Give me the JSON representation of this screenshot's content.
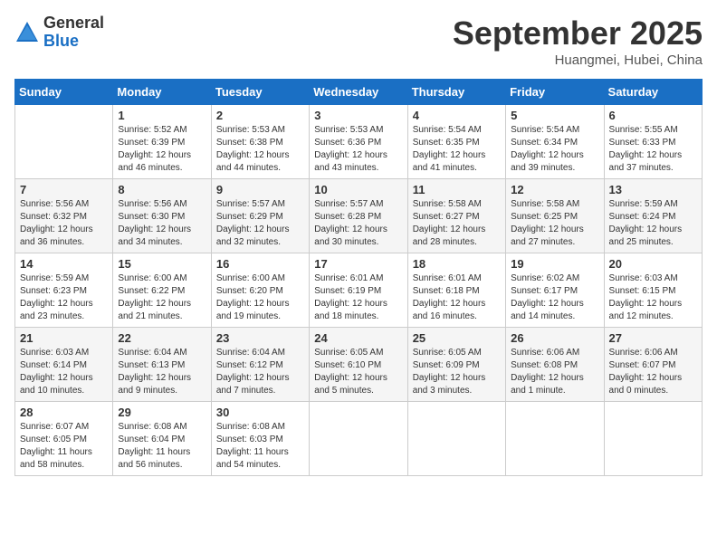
{
  "logo": {
    "general": "General",
    "blue": "Blue"
  },
  "header": {
    "month": "September 2025",
    "location": "Huangmei, Hubei, China"
  },
  "weekdays": [
    "Sunday",
    "Monday",
    "Tuesday",
    "Wednesday",
    "Thursday",
    "Friday",
    "Saturday"
  ],
  "weeks": [
    [
      {
        "day": "",
        "info": ""
      },
      {
        "day": "1",
        "info": "Sunrise: 5:52 AM\nSunset: 6:39 PM\nDaylight: 12 hours\nand 46 minutes."
      },
      {
        "day": "2",
        "info": "Sunrise: 5:53 AM\nSunset: 6:38 PM\nDaylight: 12 hours\nand 44 minutes."
      },
      {
        "day": "3",
        "info": "Sunrise: 5:53 AM\nSunset: 6:36 PM\nDaylight: 12 hours\nand 43 minutes."
      },
      {
        "day": "4",
        "info": "Sunrise: 5:54 AM\nSunset: 6:35 PM\nDaylight: 12 hours\nand 41 minutes."
      },
      {
        "day": "5",
        "info": "Sunrise: 5:54 AM\nSunset: 6:34 PM\nDaylight: 12 hours\nand 39 minutes."
      },
      {
        "day": "6",
        "info": "Sunrise: 5:55 AM\nSunset: 6:33 PM\nDaylight: 12 hours\nand 37 minutes."
      }
    ],
    [
      {
        "day": "7",
        "info": "Sunrise: 5:56 AM\nSunset: 6:32 PM\nDaylight: 12 hours\nand 36 minutes."
      },
      {
        "day": "8",
        "info": "Sunrise: 5:56 AM\nSunset: 6:30 PM\nDaylight: 12 hours\nand 34 minutes."
      },
      {
        "day": "9",
        "info": "Sunrise: 5:57 AM\nSunset: 6:29 PM\nDaylight: 12 hours\nand 32 minutes."
      },
      {
        "day": "10",
        "info": "Sunrise: 5:57 AM\nSunset: 6:28 PM\nDaylight: 12 hours\nand 30 minutes."
      },
      {
        "day": "11",
        "info": "Sunrise: 5:58 AM\nSunset: 6:27 PM\nDaylight: 12 hours\nand 28 minutes."
      },
      {
        "day": "12",
        "info": "Sunrise: 5:58 AM\nSunset: 6:25 PM\nDaylight: 12 hours\nand 27 minutes."
      },
      {
        "day": "13",
        "info": "Sunrise: 5:59 AM\nSunset: 6:24 PM\nDaylight: 12 hours\nand 25 minutes."
      }
    ],
    [
      {
        "day": "14",
        "info": "Sunrise: 5:59 AM\nSunset: 6:23 PM\nDaylight: 12 hours\nand 23 minutes."
      },
      {
        "day": "15",
        "info": "Sunrise: 6:00 AM\nSunset: 6:22 PM\nDaylight: 12 hours\nand 21 minutes."
      },
      {
        "day": "16",
        "info": "Sunrise: 6:00 AM\nSunset: 6:20 PM\nDaylight: 12 hours\nand 19 minutes."
      },
      {
        "day": "17",
        "info": "Sunrise: 6:01 AM\nSunset: 6:19 PM\nDaylight: 12 hours\nand 18 minutes."
      },
      {
        "day": "18",
        "info": "Sunrise: 6:01 AM\nSunset: 6:18 PM\nDaylight: 12 hours\nand 16 minutes."
      },
      {
        "day": "19",
        "info": "Sunrise: 6:02 AM\nSunset: 6:17 PM\nDaylight: 12 hours\nand 14 minutes."
      },
      {
        "day": "20",
        "info": "Sunrise: 6:03 AM\nSunset: 6:15 PM\nDaylight: 12 hours\nand 12 minutes."
      }
    ],
    [
      {
        "day": "21",
        "info": "Sunrise: 6:03 AM\nSunset: 6:14 PM\nDaylight: 12 hours\nand 10 minutes."
      },
      {
        "day": "22",
        "info": "Sunrise: 6:04 AM\nSunset: 6:13 PM\nDaylight: 12 hours\nand 9 minutes."
      },
      {
        "day": "23",
        "info": "Sunrise: 6:04 AM\nSunset: 6:12 PM\nDaylight: 12 hours\nand 7 minutes."
      },
      {
        "day": "24",
        "info": "Sunrise: 6:05 AM\nSunset: 6:10 PM\nDaylight: 12 hours\nand 5 minutes."
      },
      {
        "day": "25",
        "info": "Sunrise: 6:05 AM\nSunset: 6:09 PM\nDaylight: 12 hours\nand 3 minutes."
      },
      {
        "day": "26",
        "info": "Sunrise: 6:06 AM\nSunset: 6:08 PM\nDaylight: 12 hours\nand 1 minute."
      },
      {
        "day": "27",
        "info": "Sunrise: 6:06 AM\nSunset: 6:07 PM\nDaylight: 12 hours\nand 0 minutes."
      }
    ],
    [
      {
        "day": "28",
        "info": "Sunrise: 6:07 AM\nSunset: 6:05 PM\nDaylight: 11 hours\nand 58 minutes."
      },
      {
        "day": "29",
        "info": "Sunrise: 6:08 AM\nSunset: 6:04 PM\nDaylight: 11 hours\nand 56 minutes."
      },
      {
        "day": "30",
        "info": "Sunrise: 6:08 AM\nSunset: 6:03 PM\nDaylight: 11 hours\nand 54 minutes."
      },
      {
        "day": "",
        "info": ""
      },
      {
        "day": "",
        "info": ""
      },
      {
        "day": "",
        "info": ""
      },
      {
        "day": "",
        "info": ""
      }
    ]
  ]
}
